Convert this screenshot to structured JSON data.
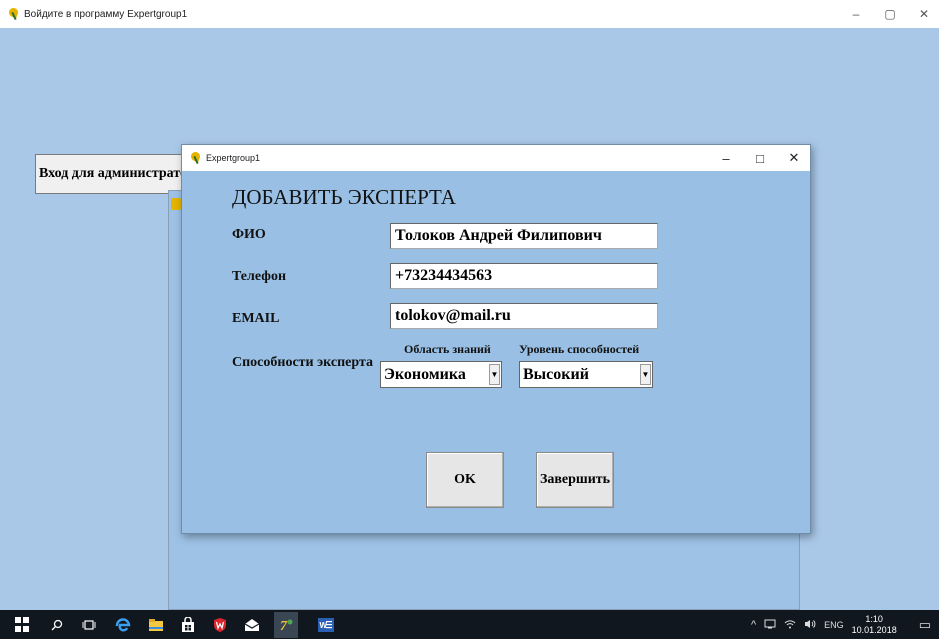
{
  "main_window": {
    "title": "Войдите в программу Expertgroup1",
    "controls": {
      "minimize": "–",
      "restore": "▢",
      "close": "✕"
    }
  },
  "admin_button": {
    "label": "Вход для администратора"
  },
  "dialog": {
    "title": "Expertgroup1",
    "controls": {
      "minimize": "–",
      "maximize": "□",
      "close": "✕"
    },
    "heading": "ДОБАВИТЬ ЭКСПЕРТА",
    "fields": {
      "fio": {
        "label": "ФИО",
        "value": "Толоков Андрей Филипович"
      },
      "phone": {
        "label": "Телефон",
        "value": "+73234434563"
      },
      "email": {
        "label": "EMAIL",
        "value": "tolokov@mail.ru"
      }
    },
    "abilities": {
      "label": "Способности эксперта",
      "knowledge_area": {
        "label": "Область знаний",
        "value": "Экономика"
      },
      "ability_level": {
        "label": "Уровень способностей",
        "value": "Высокий"
      }
    },
    "buttons": {
      "ok": "OK",
      "finish": "Завершить"
    }
  },
  "taskbar": {
    "tray": {
      "arrow": "^",
      "language": "ENG",
      "time": "1:10",
      "date": "10.01.2018",
      "notifications": "▭"
    }
  },
  "colors": {
    "desktop": "#a9c8e8",
    "dialog_bg": "#99c0e4",
    "taskbar": "#11171f"
  }
}
